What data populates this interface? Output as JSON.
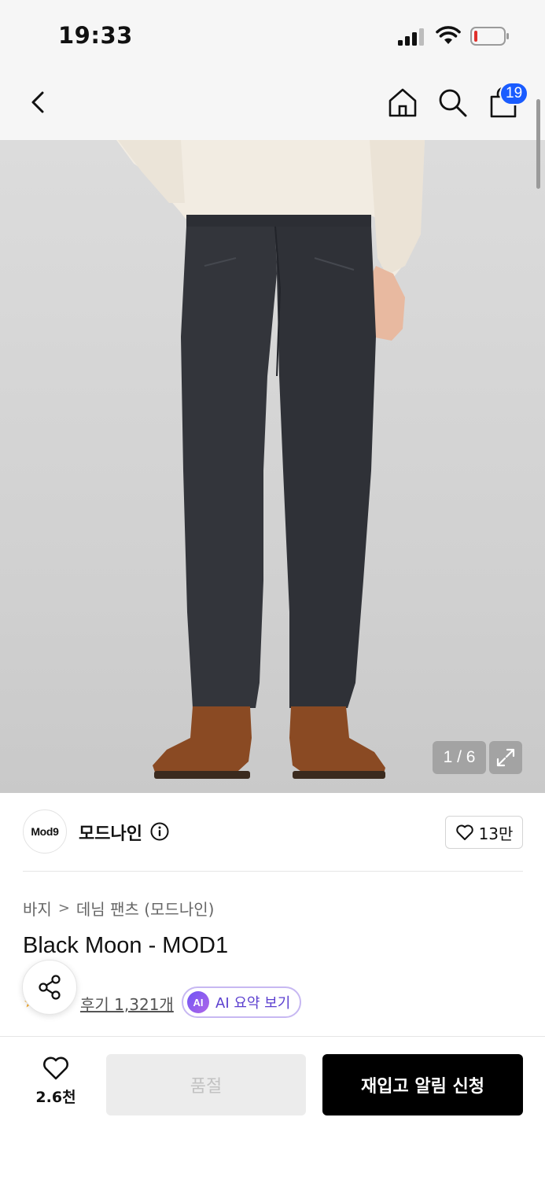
{
  "status_bar": {
    "time": "19:33"
  },
  "nav": {
    "cart_count": "19"
  },
  "gallery": {
    "counter": "1 / 6"
  },
  "brand": {
    "logo_text": "Mod9",
    "name": "모드나인",
    "likes": "13만"
  },
  "product": {
    "breadcrumb": [
      "바지",
      "데님 팬츠 (모드나인)"
    ],
    "title": "Black Moon - MOD1",
    "review_link": "후기 1,321개",
    "ai_badge": "AI",
    "ai_summary_label": "AI 요약 보기"
  },
  "bottom_bar": {
    "wish_count": "2.6천",
    "soldout_label": "품절",
    "restock_label": "재입고 알림 신청"
  },
  "colors": {
    "accent_blue": "#1a5cff",
    "ai_purple": "#5b3fcf",
    "primary_button": "#000000",
    "disabled_button": "#ececec"
  }
}
